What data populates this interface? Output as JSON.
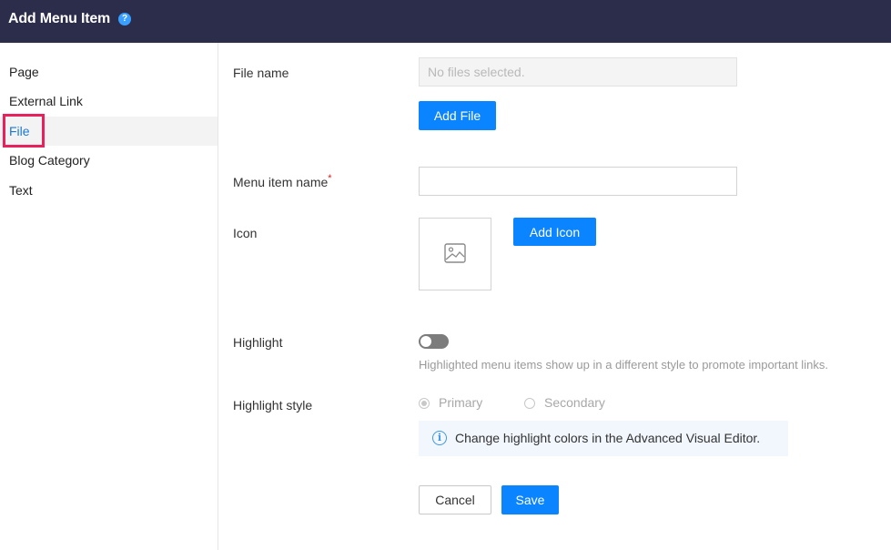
{
  "header": {
    "title": "Add Menu Item",
    "help_icon": "?"
  },
  "sidebar": {
    "items": [
      {
        "label": "Page"
      },
      {
        "label": "External Link"
      },
      {
        "label": "File",
        "active": true
      },
      {
        "label": "Blog Category"
      },
      {
        "label": "Text"
      }
    ]
  },
  "form": {
    "file_name_label": "File name",
    "file_placeholder": "No files selected.",
    "add_file_label": "Add File",
    "menu_item_name_label": "Menu item name",
    "required_marker": "*",
    "menu_item_name_value": "",
    "icon_label": "Icon",
    "icon_placeholder_icon": "image-icon",
    "add_icon_label": "Add Icon",
    "highlight_label": "Highlight",
    "highlight_on": false,
    "highlight_help": "Highlighted menu items show up in a different style to promote important links.",
    "highlight_style_label": "Highlight style",
    "style_options": [
      "Primary",
      "Secondary"
    ],
    "style_selected": "Primary",
    "info_icon": "i",
    "info_text": "Change highlight colors in the Advanced Visual Editor.",
    "cancel_label": "Cancel",
    "save_label": "Save"
  },
  "colors": {
    "header_bg": "#2b2d4b",
    "primary": "#0a84ff",
    "active_outline": "#e8205c",
    "active_text": "#1a78d6"
  }
}
